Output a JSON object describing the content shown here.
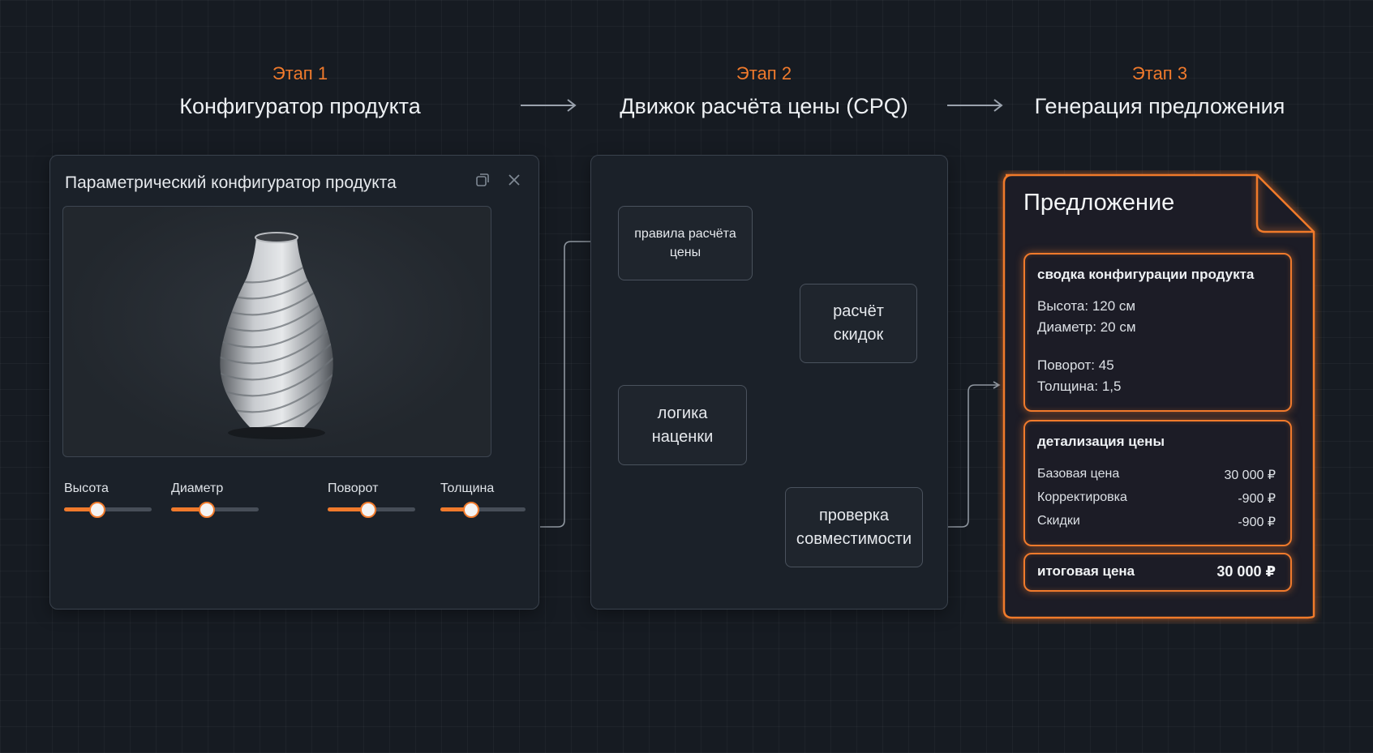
{
  "stages": [
    {
      "label": "Этап 1",
      "title": "Конфигуратор продукта"
    },
    {
      "label": "Этап 2",
      "title": "Движок расчёта цены (CPQ)"
    },
    {
      "label": "Этап 3",
      "title": "Генерация предложения"
    }
  ],
  "configurator": {
    "title": "Параметрический конфигуратор продукта",
    "icons": {
      "restore": "restore-window-icon",
      "close": "close-icon"
    },
    "sliders": [
      {
        "label": "Высота",
        "value_fraction": 0.37
      },
      {
        "label": "Диаметр",
        "value_fraction": 0.4
      },
      {
        "label": "Поворот",
        "value_fraction": 0.45
      },
      {
        "label": "Толщина",
        "value_fraction": 0.35
      }
    ]
  },
  "cpq": {
    "nodes": {
      "rules": "правила расчёта цены",
      "discounts": "расчёт скидок",
      "markup": "логика наценки",
      "compat": "проверка совместимости"
    }
  },
  "offer": {
    "title": "Предложение",
    "summary": {
      "title": "сводка конфигурации продукта",
      "height": "Высота: 120 см",
      "diameter": "Диаметр: 20 см",
      "rotation": "Поворот: 45",
      "thickness": "Толщина: 1,5"
    },
    "breakdown": {
      "title": "детализация цены",
      "rows": [
        {
          "label": "Базовая цена",
          "value": "30 000 ₽"
        },
        {
          "label": "Корректировка",
          "value": "-900 ₽"
        },
        {
          "label": "Скидки",
          "value": "-900 ₽"
        }
      ]
    },
    "total": {
      "label": "итоговая цена",
      "value": "30 000 ₽"
    }
  },
  "colors": {
    "accent": "#f07a2c",
    "background": "#161b22",
    "panel": "#1b2129"
  }
}
